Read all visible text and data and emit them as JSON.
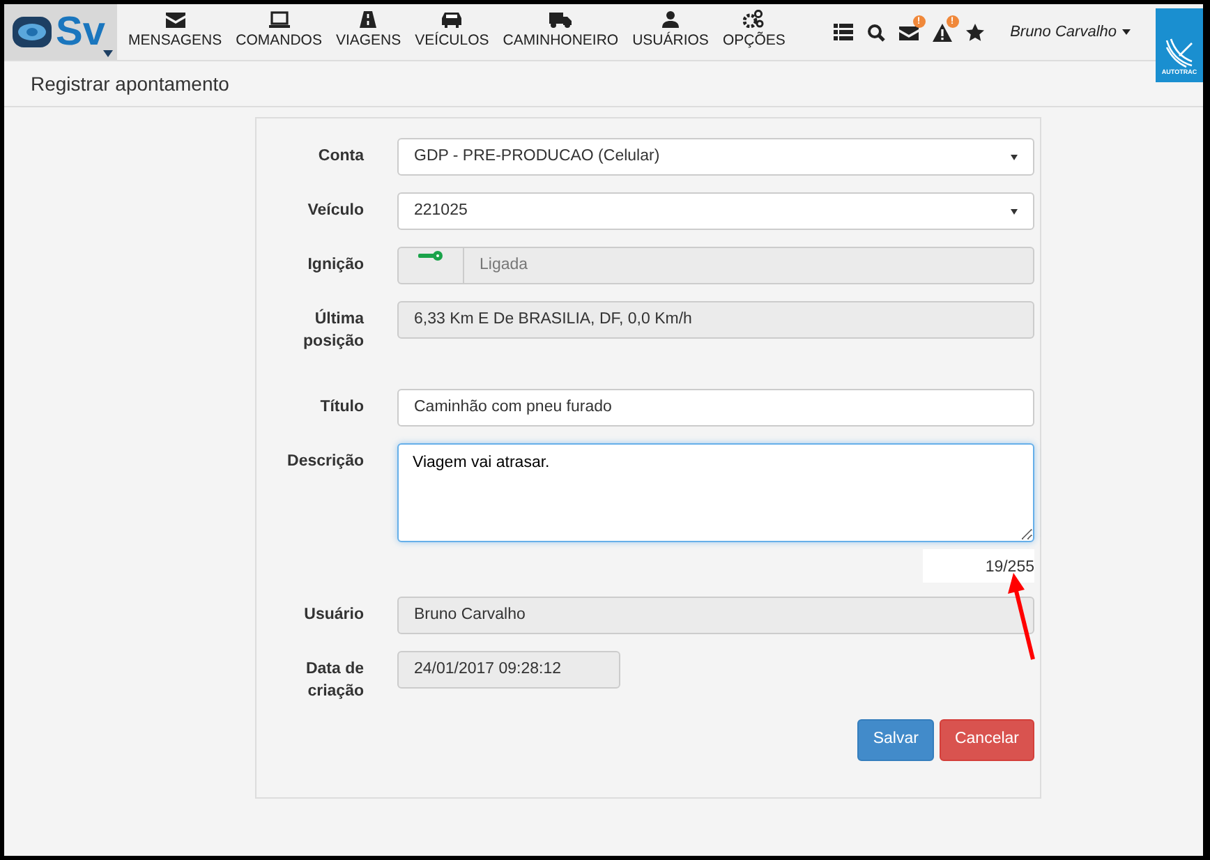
{
  "logo": {
    "text": "Sv"
  },
  "nav": [
    {
      "label": "MENSAGENS"
    },
    {
      "label": "COMANDOS"
    },
    {
      "label": "VIAGENS"
    },
    {
      "label": "VEÍCULOS"
    },
    {
      "label": "CAMINHONEIRO"
    },
    {
      "label": "USUÁRIOS"
    },
    {
      "label": "OPÇÕES"
    }
  ],
  "toolbar": [
    {
      "kind": "list"
    },
    {
      "kind": "search"
    },
    {
      "kind": "mail",
      "badge": "!"
    },
    {
      "kind": "alert",
      "badge": "!"
    },
    {
      "kind": "star"
    }
  ],
  "user": "Bruno Carvalho",
  "brand": "AUTOTRAC",
  "page_title": "Registrar apontamento",
  "fields": [
    {
      "label": "Conta",
      "kind": "select",
      "value": "GDP - PRE-PRODUCAO (Celular)"
    },
    {
      "label": "Veículo",
      "kind": "select",
      "value": "221025"
    },
    {
      "label": "Ignição",
      "kind": "ignition",
      "value": "Ligada",
      "on": true
    },
    {
      "label": "Última posição",
      "kind": "readonly",
      "value": "6,33 Km E De BRASILIA, DF, 0,0 Km/h"
    },
    {
      "label": "Título",
      "kind": "input",
      "value": "Caminhão com pneu furado"
    },
    {
      "label": "Descrição",
      "kind": "textarea",
      "value": "Viagem vai atrasar.",
      "counter": "19/255"
    },
    {
      "label": "Usuário",
      "kind": "readonly",
      "value": "Bruno Carvalho"
    },
    {
      "label": "Data de criação",
      "kind": "readonly_short",
      "value": "24/01/2017 09:28:12"
    }
  ],
  "buttons": [
    {
      "label": "Salvar",
      "kind": "primary"
    },
    {
      "label": "Cancelar",
      "kind": "danger"
    }
  ]
}
